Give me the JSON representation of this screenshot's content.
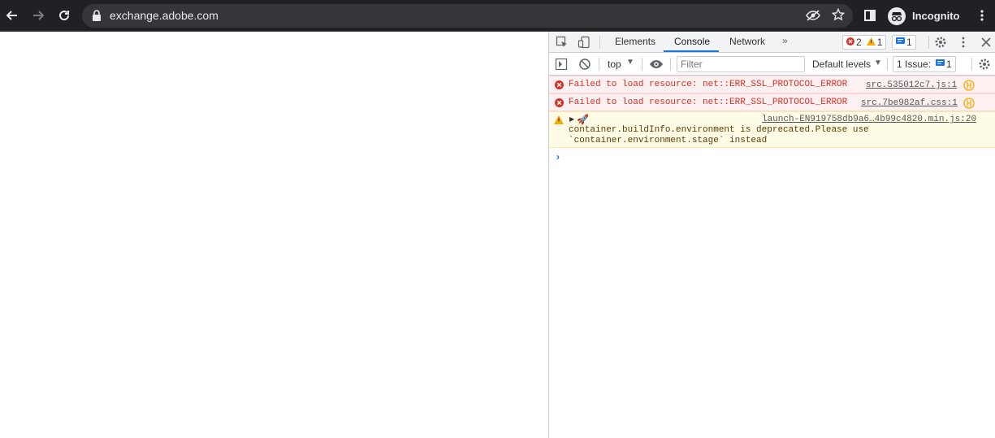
{
  "browser": {
    "url": "exchange.adobe.com",
    "profile_label": "Incognito",
    "toolbar_bg": "#202124"
  },
  "devtools": {
    "tabs": [
      "Elements",
      "Console",
      "Network"
    ],
    "active_tab": "Console",
    "error_count": "2",
    "warning_count": "1",
    "issue_count_top": "1",
    "context": "top",
    "filter_placeholder": "Filter",
    "levels": "Default levels",
    "issues_label": "1 Issue:",
    "issues_count": "1",
    "messages": [
      {
        "level": "error",
        "text": "Failed to load resource: net::ERR_SSL_PROTOCOL_ERROR",
        "source": "src.535012c7.js:1"
      },
      {
        "level": "error",
        "text": "Failed to load resource: net::ERR_SSL_PROTOCOL_ERROR",
        "source": "src.7be982af.css:1"
      },
      {
        "level": "warning",
        "prefix": "🚀",
        "source": "launch-EN919758db9a6…4b99c4820.min.js:20",
        "line1": "container.buildInfo.environment is deprecated.Please use",
        "line2": "`container.environment.stage` instead"
      }
    ]
  },
  "colors": {
    "accent": "#1a73e8",
    "error": "#d93025",
    "warning": "#f9ab00"
  }
}
